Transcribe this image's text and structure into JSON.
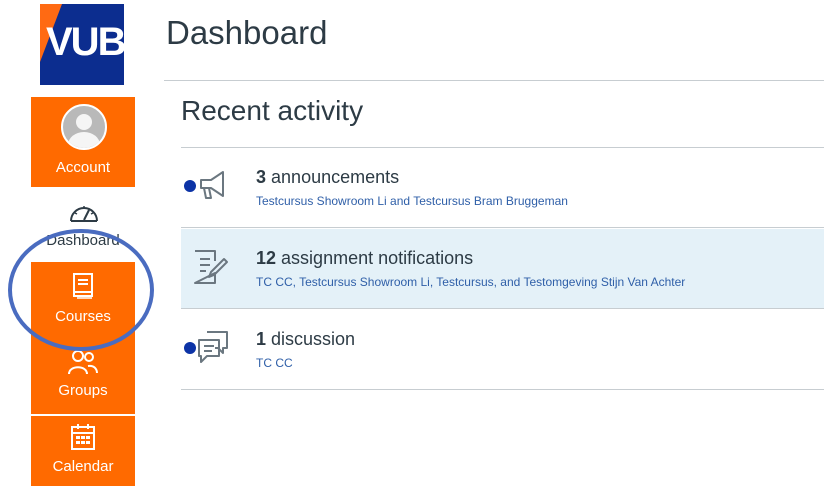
{
  "logo": {
    "text": "VUB"
  },
  "nav": {
    "account": "Account",
    "dashboard": "Dashboard",
    "courses": "Courses",
    "groups": "Groups",
    "calendar": "Calendar"
  },
  "page": {
    "title": "Dashboard"
  },
  "recent": {
    "title": "Recent activity",
    "items": [
      {
        "count": "3",
        "label": "announcements",
        "courses": "Testcursus Showroom Li and Testcursus Bram Bruggeman",
        "icon": "megaphone-icon",
        "unread": true
      },
      {
        "count": "12",
        "label": "assignment notifications",
        "courses": "TC CC, Testcursus Showroom Li, Testcursus, and Testomgeving Stijn Van Achter",
        "icon": "assignment-icon",
        "unread": false
      },
      {
        "count": "1",
        "label": "discussion",
        "courses": "TC CC",
        "icon": "discussion-icon",
        "unread": true
      }
    ]
  },
  "colors": {
    "brand_orange": "#ff6a00",
    "brand_blue": "#0c2d8f",
    "highlight": "#e4f1f8",
    "link": "#2f5fa8"
  }
}
